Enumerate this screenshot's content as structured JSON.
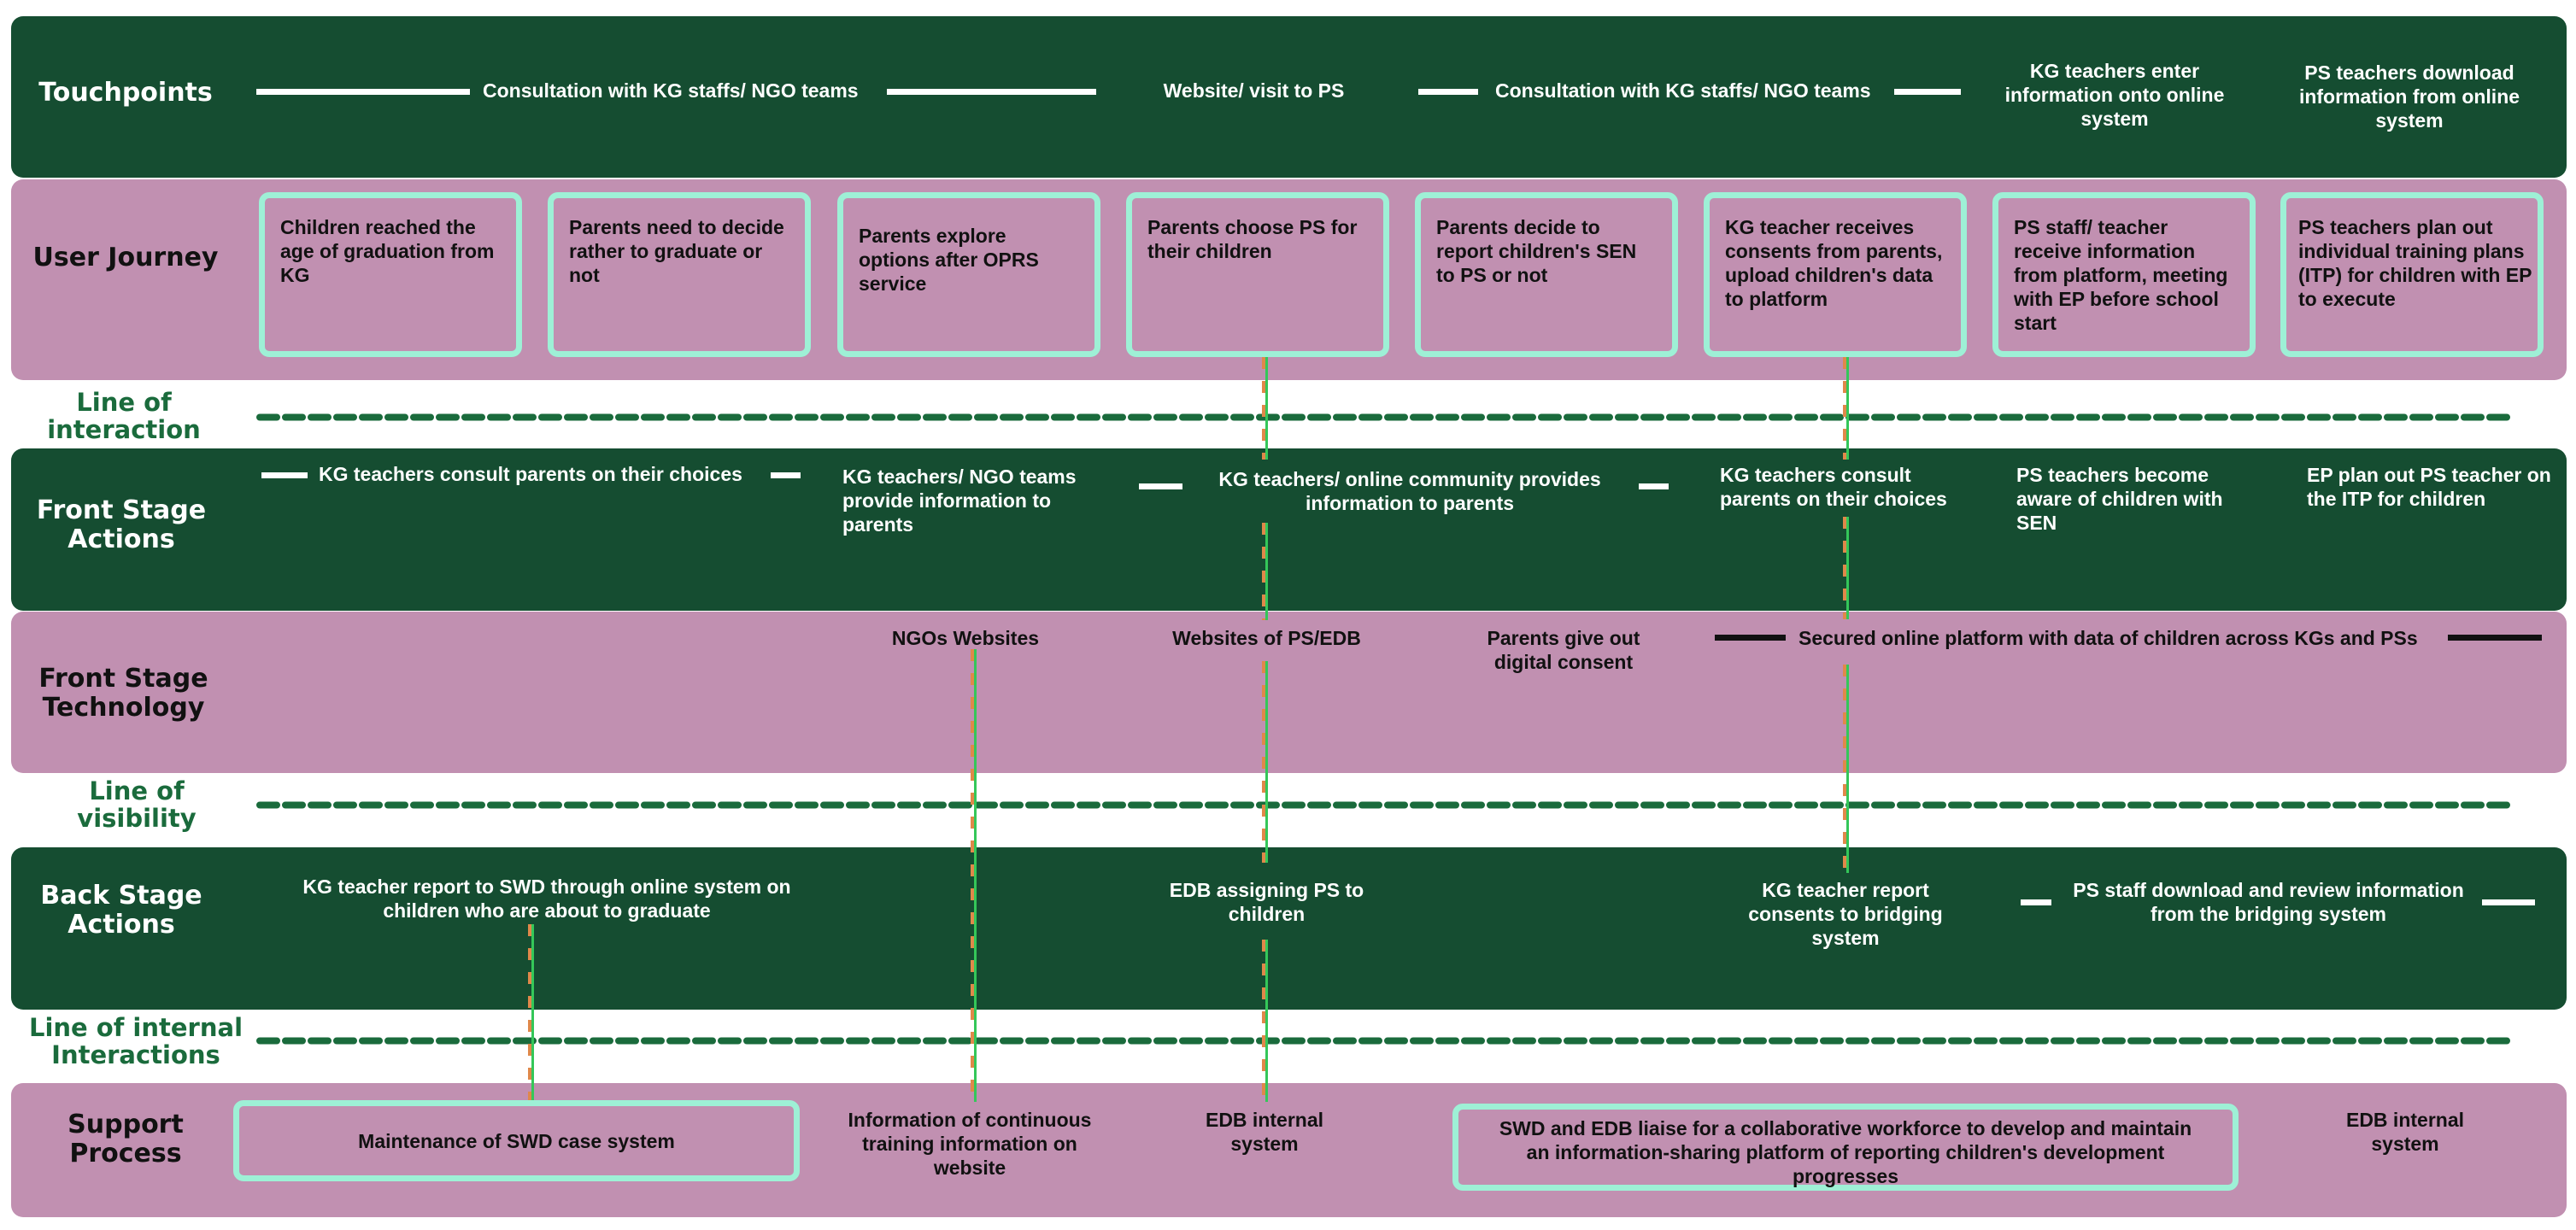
{
  "lanes": {
    "touchpoints": "Touchpoints",
    "user_journey": "User Journey",
    "line_interaction": "Line of interaction",
    "front_stage_actions": "Front Stage Actions",
    "front_stage_technology": "Front Stage Technology",
    "line_visibility": "Line of visibility",
    "back_stage_actions": "Back Stage Actions",
    "line_internal": "Line of internal Interactions",
    "support_process": "Support Process"
  },
  "touchpoints": [
    "Consultation with KG staffs/ NGO teams",
    "Website/ visit to PS",
    "Consultation with KG staffs/ NGO teams",
    "KG teachers enter information onto online system",
    "PS teachers download information from online system"
  ],
  "user_journey": [
    "Children reached the age of graduation from KG",
    "Parents need to decide rather to graduate or not",
    "Parents explore options after OPRS service",
    "Parents choose PS for their children",
    "Parents decide to report children's SEN to PS or not",
    "KG teacher receives consents from parents, upload children's data to platform",
    "PS staff/ teacher receive information from  platform, meeting with EP before school start",
    "PS teachers plan out individual training plans (ITP) for children with EP to execute"
  ],
  "front_stage_actions": [
    "KG teachers consult parents on their choices",
    "KG teachers/ NGO teams provide information to parents",
    "KG teachers/ online community provides information to parents",
    "KG teachers consult parents on their choices",
    "PS teachers become aware of children with SEN",
    "EP plan out PS teacher on the ITP for children"
  ],
  "front_stage_technology": [
    "NGOs Websites",
    "Websites of PS/EDB",
    "Parents give out digital consent",
    "Secured online platform with data of children across KGs and PSs"
  ],
  "back_stage_actions": [
    "KG teacher report to SWD through online system on children who are about to graduate",
    "EDB assigning PS to children",
    "KG teacher report consents to bridging system",
    "PS staff download and review information from the bridging system"
  ],
  "support_process": [
    "Maintenance of SWD case system",
    "Information of continuous training information on website",
    "EDB internal system",
    "SWD and EDB liaise for a collaborative workforce to develop and maintain an information-sharing platform of reporting children's development progresses",
    "EDB internal system"
  ],
  "colors": {
    "dark_band": "#154d31",
    "pink_band": "#c190b1",
    "box_border": "#9ef0d6",
    "line_label": "#1a6b3c",
    "connector_green": "#34c759",
    "connector_orange": "#e0884a"
  }
}
